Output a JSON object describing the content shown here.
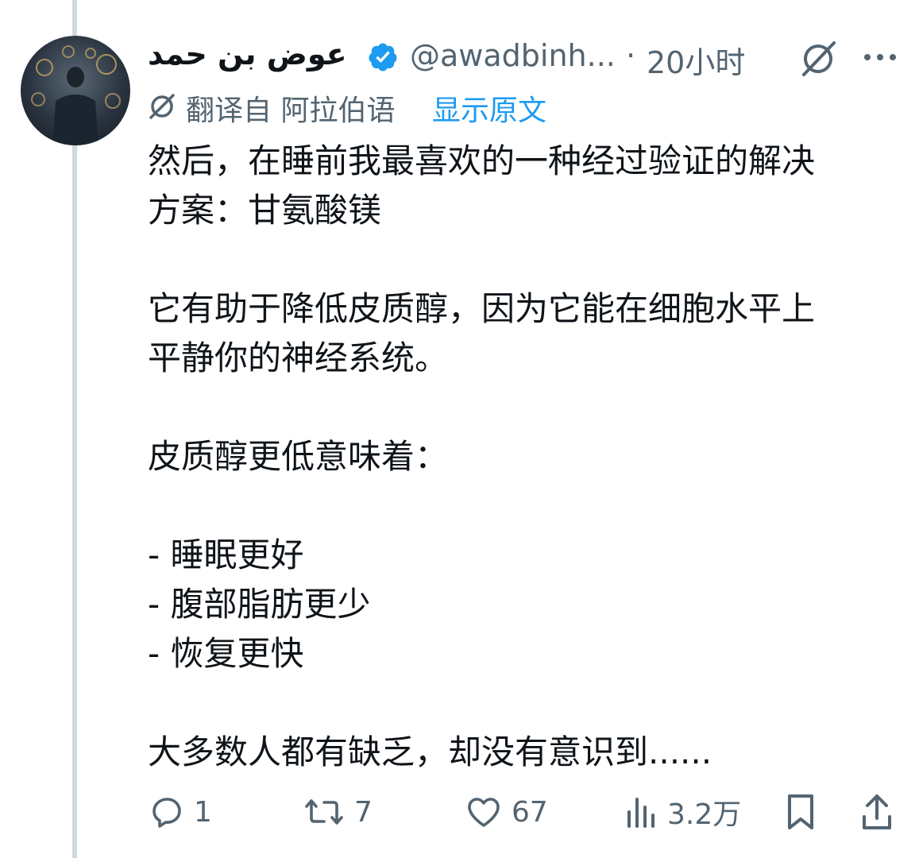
{
  "author": {
    "display_name": "عوض بن حمد",
    "handle": "@awadbinh...",
    "separator": "·",
    "time_ago": "20小时",
    "verified": true,
    "avatar_icon": "man-silhouette-avatar"
  },
  "translation": {
    "label": "翻译自 阿拉伯语",
    "show_original": "显示原文",
    "icon": "translate-icon"
  },
  "tweet": {
    "lines": [
      "然后，在睡前我最喜欢的一种经过验证的解决",
      "方案：甘氨酸镁",
      "",
      "它有助于降低皮质醇，因为它能在细胞水平上",
      "平静你的神经系统。",
      "",
      "皮质醇更低意味着：",
      "",
      "- 睡眠更好",
      "- 腹部脂肪更少",
      "- 恢复更快",
      "",
      "大多数人都有缺乏，却没有意识到......"
    ]
  },
  "actions": {
    "reply": {
      "icon": "reply-icon",
      "count": "1"
    },
    "repost": {
      "icon": "repost-icon",
      "count": "7"
    },
    "like": {
      "icon": "heart-icon",
      "count": "67"
    },
    "views": {
      "icon": "views-icon",
      "count": "3.2万"
    },
    "bookmark": {
      "icon": "bookmark-icon"
    },
    "share": {
      "icon": "share-icon"
    }
  },
  "colors": {
    "text": "#0f1419",
    "secondary": "#536471",
    "link": "#1d9bf0",
    "verified_badge": "#1d9bf0",
    "thread_line": "#cfd9de"
  }
}
